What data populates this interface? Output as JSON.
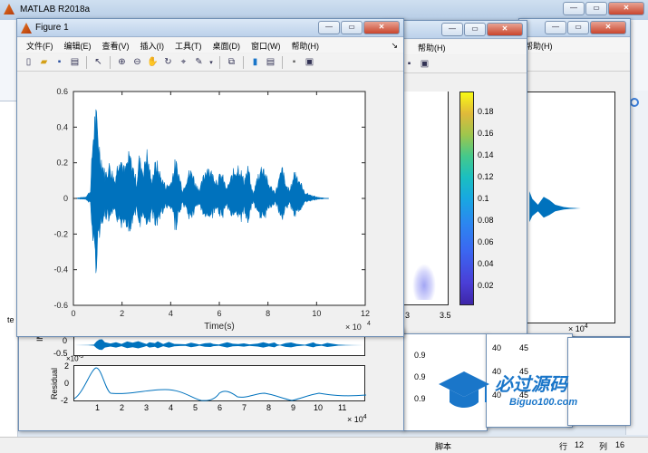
{
  "main_window": {
    "title": "MATLAB R2018a",
    "left_label": "te"
  },
  "figure1": {
    "title": "Figure 1",
    "menu": [
      "文件(F)",
      "编辑(E)",
      "查看(V)",
      "插入(I)",
      "工具(T)",
      "桌面(D)",
      "窗口(W)",
      "帮助(H)"
    ],
    "menu_arrow": "↘",
    "toolbar_icons": [
      "new-icon",
      "open-icon",
      "save-icon",
      "print-icon",
      "pointer-icon",
      "zoom-in-icon",
      "zoom-out-icon",
      "pan-icon",
      "rotate-icon",
      "data-cursor-icon",
      "brush-icon",
      "link-icon",
      "colorbar-icon",
      "legend-icon",
      "hide-plot-tools-icon",
      "show-plot-tools-icon"
    ]
  },
  "figure2": {
    "help": "帮助(H)",
    "xticks": [
      "3",
      "3.5"
    ]
  },
  "figure3": {
    "help": "帮助(H)",
    "xmult": "× 10",
    "xexp": "4"
  },
  "colorbar": {
    "ticks": [
      "0.18",
      "0.16",
      "0.14",
      "0.12",
      "0.1",
      "0.08",
      "0.06",
      "0.04",
      "0.02"
    ]
  },
  "bottom_figure": {
    "imf_label": "IMF",
    "imf_ticks": [
      "0",
      "-0.5"
    ],
    "imf_exp": "-3",
    "residual_label": "Residual",
    "residual_ticks": [
      "2",
      "0",
      "-2"
    ],
    "xticks": [
      "1",
      "2",
      "3",
      "4",
      "5",
      "6",
      "7",
      "8",
      "9",
      "10",
      "11"
    ],
    "xmult": "× 10",
    "xexp": "4"
  },
  "mid_table": {
    "values": [
      "0.9",
      "0.9",
      "0.9"
    ]
  },
  "right_table": {
    "values": [
      "40",
      "45",
      "40",
      "45",
      "40",
      "45"
    ]
  },
  "status": {
    "script": "脚本",
    "row_label": "行",
    "row": "12",
    "col_label": "列",
    "col": "16"
  },
  "watermark": {
    "big": "必过源码",
    "small": "Biguo100.com"
  },
  "chart_data": {
    "type": "line",
    "title": "",
    "xlabel": "Time(s)",
    "ylabel": "",
    "xlim": [
      0,
      12
    ],
    "ylim": [
      -0.6,
      0.6
    ],
    "x_multiplier": "× 10",
    "x_exponent": "4",
    "xticks": [
      "0",
      "2",
      "4",
      "6",
      "8",
      "10",
      "12"
    ],
    "yticks": [
      "0.6",
      "0.4",
      "0.2",
      "0",
      "-0.2",
      "-0.4",
      "-0.6"
    ],
    "series": [
      {
        "color": "#0072BD",
        "envelope": [
          [
            0.0,
            0.0
          ],
          [
            0.5,
            0.01
          ],
          [
            0.7,
            0.05
          ],
          [
            0.8,
            0.4
          ],
          [
            0.9,
            0.56
          ],
          [
            1.0,
            0.45
          ],
          [
            1.1,
            0.3
          ],
          [
            1.3,
            0.16
          ],
          [
            1.5,
            0.22
          ],
          [
            1.7,
            0.12
          ],
          [
            1.9,
            0.3
          ],
          [
            2.1,
            0.18
          ],
          [
            2.3,
            0.28
          ],
          [
            2.5,
            0.18
          ],
          [
            2.6,
            0.1
          ],
          [
            2.7,
            0.26
          ],
          [
            2.9,
            0.18
          ],
          [
            3.0,
            0.32
          ],
          [
            3.2,
            0.12
          ],
          [
            3.4,
            0.24
          ],
          [
            3.6,
            0.14
          ],
          [
            3.8,
            0.08
          ],
          [
            4.0,
            0.1
          ],
          [
            4.2,
            0.24
          ],
          [
            4.4,
            0.12
          ],
          [
            4.5,
            0.05
          ],
          [
            4.7,
            0.16
          ],
          [
            4.9,
            0.18
          ],
          [
            5.0,
            0.1
          ],
          [
            5.2,
            0.06
          ],
          [
            5.5,
            0.22
          ],
          [
            5.7,
            0.16
          ],
          [
            5.9,
            0.12
          ],
          [
            6.1,
            0.16
          ],
          [
            6.3,
            0.06
          ],
          [
            6.6,
            0.18
          ],
          [
            6.8,
            0.22
          ],
          [
            7.0,
            0.12
          ],
          [
            7.2,
            0.2
          ],
          [
            7.3,
            0.08
          ],
          [
            7.4,
            0.03
          ],
          [
            7.6,
            0.16
          ],
          [
            7.8,
            0.22
          ],
          [
            8.0,
            0.1
          ],
          [
            8.3,
            0.04
          ],
          [
            8.6,
            0.2
          ],
          [
            8.7,
            0.1
          ],
          [
            8.9,
            0.05
          ],
          [
            9.1,
            0.18
          ],
          [
            9.3,
            0.12
          ],
          [
            9.5,
            0.04
          ],
          [
            9.8,
            0.02
          ],
          [
            10.0,
            0.01
          ],
          [
            10.4,
            0.0
          ]
        ]
      }
    ]
  }
}
